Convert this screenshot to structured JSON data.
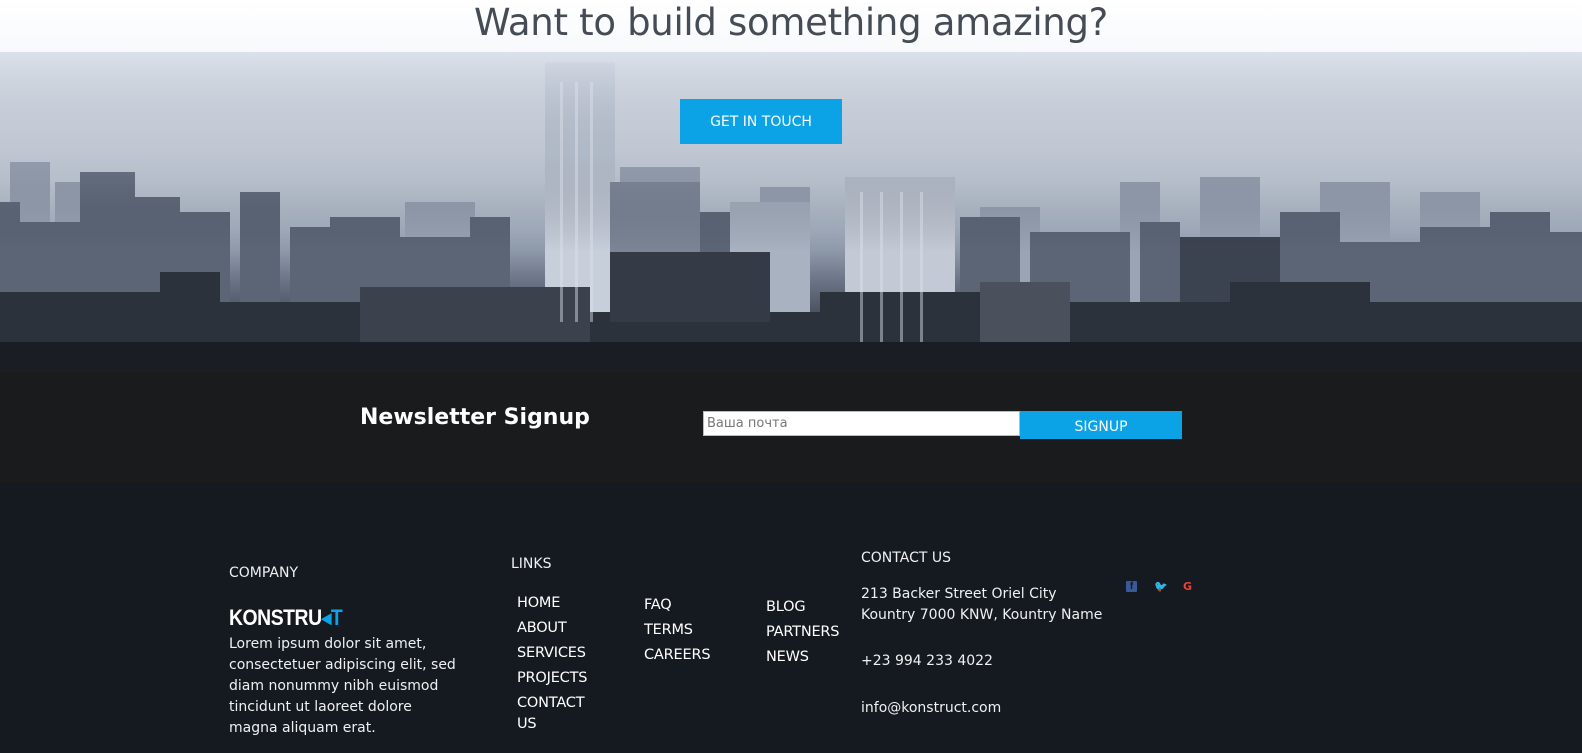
{
  "hero": {
    "title": "Want to build something amazing?",
    "cta_label": "GET IN TOUCH"
  },
  "newsletter": {
    "title": "Newsletter Signup",
    "input_placeholder": "Ваша почта",
    "button_label": "SIGNUP"
  },
  "footer": {
    "company": {
      "heading": "COMPANY",
      "logo_text": "KONSTRU",
      "logo_mark": "◂T",
      "description": "Lorem ipsum dolor sit amet, consectetuer adipiscing elit, sed diam nonummy nibh euismod tincidunt ut laoreet dolore magna aliquam erat."
    },
    "links": {
      "heading": "LINKS",
      "col1": [
        "HOME",
        "ABOUT",
        "SERVICES",
        "PROJECTS",
        "CONTACT US"
      ],
      "col2": [
        "FAQ",
        "TERMS",
        "CAREERS"
      ],
      "col3": [
        "BLOG",
        "PARTNERS",
        "NEWS"
      ]
    },
    "contact": {
      "heading": "CONTACT US",
      "address_line1": "213 Backer Street Oriel City",
      "address_line2": "Kountry 7000 KNW, Kountry Name",
      "phone": "+23 994 233 4022",
      "email": "info@konstruct.com"
    },
    "social": {
      "facebook": "f",
      "twitter": "🐦",
      "google": "G"
    }
  },
  "colors": {
    "accent": "#0ba3e6",
    "newsletter_bg": "#1a1b1d",
    "footer_bg": "#151a20"
  }
}
